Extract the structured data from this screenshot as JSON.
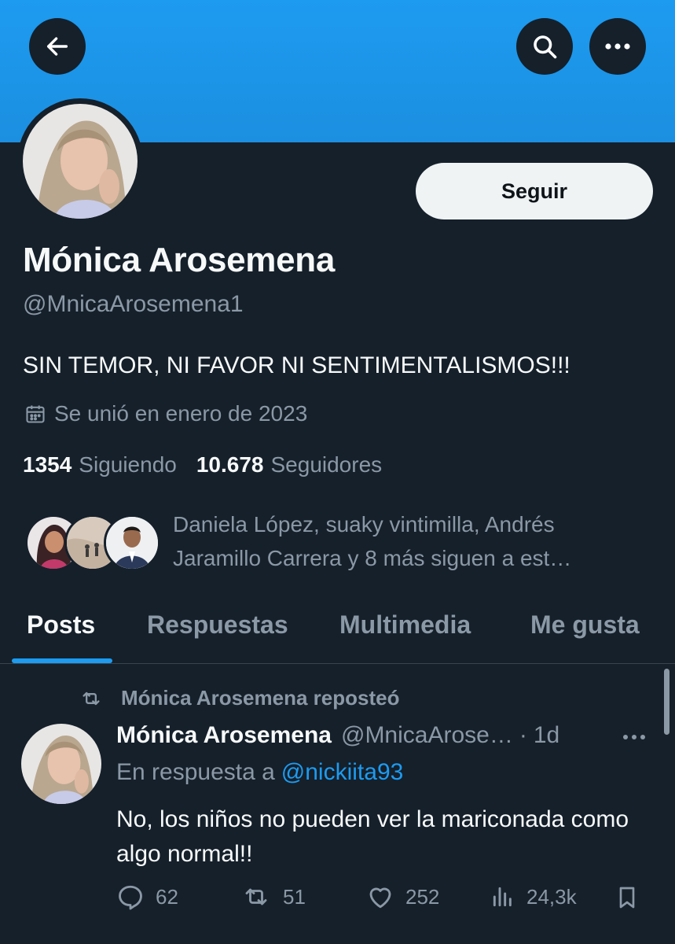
{
  "profile": {
    "follow_label": "Seguir",
    "name": "Mónica Arosemena",
    "handle": "@MnicaArosemena1",
    "bio": "SIN TEMOR, NI FAVOR NI SENTIMENTALISMOS!!!",
    "joined": "Se unió en enero de 2023",
    "following_count": "1354",
    "following_label": "Siguiendo",
    "followers_count": "10.678",
    "followers_label": "Seguidores",
    "followed_by": "Daniela López, suaky vintimilla, Andrés Jaramillo Carrera y 8 más siguen a est…"
  },
  "icons": {
    "back": "arrow-left-icon",
    "search": "search-icon",
    "more": "more-icon",
    "calendar": "calendar-icon",
    "repost": "repost-icon",
    "reply": "reply-icon",
    "like": "heart-icon",
    "views": "views-icon",
    "bookmark": "bookmark-icon"
  },
  "tabs": [
    {
      "label": "Posts",
      "active": true
    },
    {
      "label": "Respuestas",
      "active": false
    },
    {
      "label": "Multimedia",
      "active": false
    },
    {
      "label": "Me gusta",
      "active": false
    }
  ],
  "post": {
    "repost_notice": "Mónica Arosemena reposteó",
    "author_name": "Mónica Arosemena",
    "author_handle": "@MnicaArose…",
    "separator": "·",
    "time": "1d",
    "reply_prefix": "En respuesta a",
    "reply_mention": "@nickiita93",
    "text": "No, los niños no pueden ver la mariconada como algo normal!!",
    "replies": "62",
    "reposts": "51",
    "likes": "252",
    "views": "24,3k"
  },
  "colors": {
    "banner": "#1d9bf0",
    "background": "#15202b",
    "accent": "#1d9bf0",
    "secondary_text": "#8b98a5"
  }
}
